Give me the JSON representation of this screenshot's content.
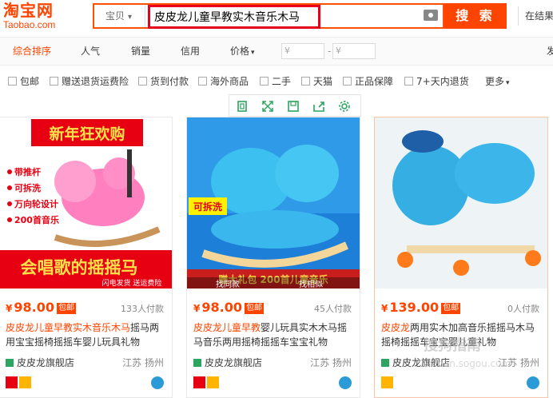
{
  "logo": {
    "cn": "淘宝网",
    "en": "Taobao.com"
  },
  "search": {
    "scope": "宝贝",
    "query": "皮皮龙儿童早教实木音乐木马",
    "button": "搜 索"
  },
  "nav": {
    "right": "在结果"
  },
  "sort": {
    "items": [
      "综合排序",
      "人气",
      "销量",
      "信用",
      "价格"
    ],
    "price_from_placeholder": "¥",
    "price_to_placeholder": "¥",
    "dash": "-",
    "right_clip": "发"
  },
  "filters": [
    "包邮",
    "赠送退货运费险",
    "货到付款",
    "海外商品",
    "二手",
    "天猫",
    "正品保障",
    "7+天内退货",
    "更多"
  ],
  "products": [
    {
      "img_banner": "新年狂欢购",
      "img_tags": [
        "带推杆",
        "可拆洗",
        "万向轮设计",
        "200首音乐"
      ],
      "img_bottom": "会唱歌的摇摇马",
      "img_bottom2": "闪电发货 送运费险",
      "price_symbol": "¥",
      "price": "98.00",
      "badge": "包邮",
      "sold": "133人付款",
      "title_hl": "皮皮龙儿童早教实木音乐木马",
      "title_rest": "摇马两用宝宝摇椅摇摇车婴儿玩具礼物",
      "shop": "皮皮龙旗舰店",
      "location": "江苏 扬州"
    },
    {
      "img_tag": "可拆洗",
      "img_bottom": "赠大礼包 200首儿童音乐",
      "img_left": "找同款",
      "img_right": "找相似",
      "price_symbol": "¥",
      "price": "98.00",
      "badge": "包邮",
      "sold": "45人付款",
      "title_hl": "皮皮龙儿童早教",
      "title_rest": "婴儿玩具实木木马摇马音乐两用摇椅摇摇车宝宝礼物",
      "shop": "皮皮龙旗舰店",
      "location": "江苏 扬州"
    },
    {
      "price_symbol": "¥",
      "price": "139.00",
      "badge": "包邮",
      "sold": "0人付款",
      "title_hl": "皮皮龙",
      "title_rest": "两用实木加高音乐摇摇马木马摇椅摇摇车宝宝婴儿童礼物",
      "shop": "皮皮龙旗舰店",
      "location": "江苏 扬州"
    }
  ],
  "watermark": {
    "line1": "搜狗指南",
    "line2": "zhinan.sogou.com"
  },
  "colors": {
    "accent": "#ff4400",
    "highlight_border": "#e8001c",
    "tool_green": "#2ba55f"
  }
}
